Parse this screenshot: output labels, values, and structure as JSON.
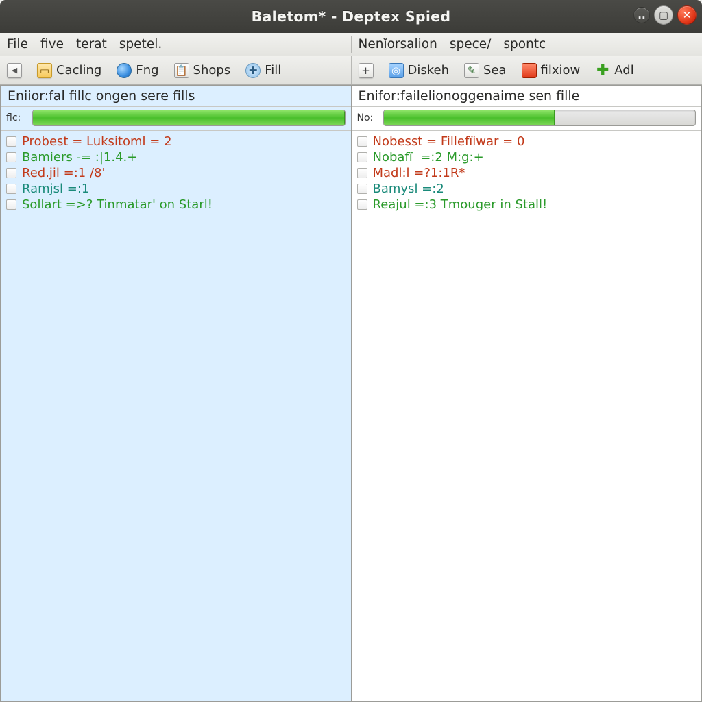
{
  "window": {
    "title": "Baletom* - Deptex Spied",
    "min_tip": "..",
    "max_tip": "❐",
    "close_tip": "✕"
  },
  "menubar": {
    "left": [
      "File",
      "five",
      "terat",
      "spetel."
    ],
    "right": [
      "Nenĭorsalion",
      "spece/",
      "spontc"
    ]
  },
  "toolbar": {
    "left": [
      {
        "icon": "left-icon",
        "label": ""
      },
      {
        "icon": "folder-icon",
        "label": "Cacling"
      },
      {
        "icon": "globe-icon",
        "label": "Fng"
      },
      {
        "icon": "clip-icon",
        "label": "Shops"
      },
      {
        "icon": "target-icon",
        "label": "Fill"
      }
    ],
    "right": [
      {
        "icon": "plus-box-icon",
        "label": ""
      },
      {
        "icon": "disk-icon",
        "label": "Diskeh"
      },
      {
        "icon": "edit-icon",
        "label": "Sea"
      },
      {
        "icon": "red-box-icon",
        "label": "filxiow"
      },
      {
        "icon": "add-icon",
        "label": "Adl"
      }
    ]
  },
  "left_panel": {
    "header": "Eniior:fal fillc ongen sere fills",
    "progress": {
      "label": "flc:",
      "percent": 100
    },
    "rows": [
      {
        "color": "red",
        "text": "Probest = Luksitoml = 2"
      },
      {
        "color": "green",
        "text": "Bamiers -= :|1.4.+"
      },
      {
        "color": "red",
        "text": "Red.jil =:1 /8'"
      },
      {
        "color": "teal",
        "text": "Ramjsl =:1"
      },
      {
        "color": "green",
        "text": "Sollart =>? Tinmatar' on Starl!"
      }
    ]
  },
  "right_panel": {
    "header": "Enifor:failelionoggenaime sen fille",
    "progress": {
      "label": "No:",
      "percent": 55
    },
    "rows": [
      {
        "color": "red",
        "text": "Nobesst = Fillefïiwar = 0"
      },
      {
        "color": "green",
        "text": "Nobafï  =:2 M:g:+"
      },
      {
        "color": "red",
        "text": "Madl:l =?1:1R*"
      },
      {
        "color": "teal",
        "text": "Bamysl =:2"
      },
      {
        "color": "green",
        "text": "Reajul =:3 Tmouger in Stall!"
      }
    ]
  }
}
